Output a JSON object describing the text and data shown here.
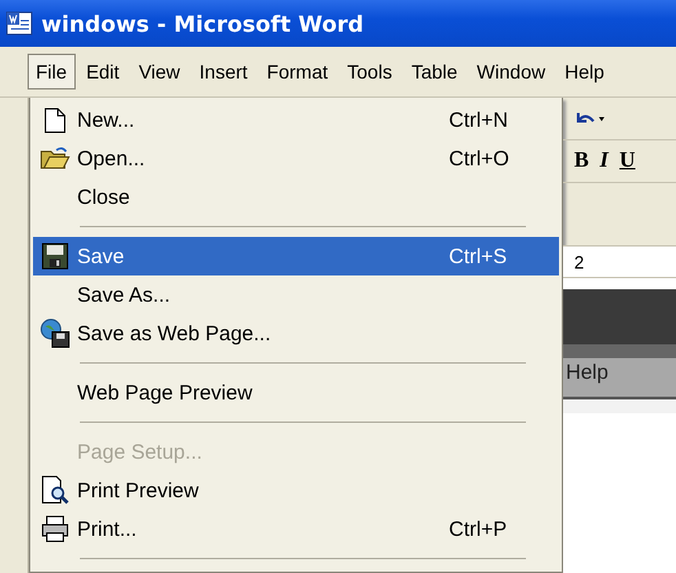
{
  "window": {
    "title": "windows - Microsoft Word"
  },
  "menu_bar": [
    {
      "label": "File",
      "selected": true
    },
    {
      "label": "Edit",
      "selected": false
    },
    {
      "label": "View",
      "selected": false
    },
    {
      "label": "Insert",
      "selected": false
    },
    {
      "label": "Format",
      "selected": false
    },
    {
      "label": "Tools",
      "selected": false
    },
    {
      "label": "Table",
      "selected": false
    },
    {
      "label": "Window",
      "selected": false
    },
    {
      "label": "Help",
      "selected": false
    }
  ],
  "file_menu": [
    {
      "kind": "item",
      "label": "New...",
      "shortcut": "Ctrl+N",
      "selected": false,
      "disabled": false
    },
    {
      "kind": "item",
      "label": "Open...",
      "shortcut": "Ctrl+O",
      "selected": false,
      "disabled": false
    },
    {
      "kind": "item",
      "label": "Close",
      "selected": false,
      "disabled": false
    },
    {
      "kind": "separator"
    },
    {
      "kind": "item",
      "label": "Save",
      "shortcut": "Ctrl+S",
      "selected": true,
      "disabled": false
    },
    {
      "kind": "item",
      "label": "Save As...",
      "selected": false,
      "disabled": false
    },
    {
      "kind": "item",
      "label": "Save as Web Page...",
      "selected": false,
      "disabled": false
    },
    {
      "kind": "separator"
    },
    {
      "kind": "item",
      "label": "Web Page Preview",
      "selected": false,
      "disabled": false
    },
    {
      "kind": "separator"
    },
    {
      "kind": "item",
      "label": "Page Setup...",
      "selected": false,
      "disabled": true
    },
    {
      "kind": "item",
      "label": "Print Preview",
      "selected": false,
      "disabled": false
    },
    {
      "kind": "item",
      "label": "Print...",
      "shortcut": "Ctrl+P",
      "selected": false,
      "disabled": false
    },
    {
      "kind": "separator"
    }
  ],
  "format_toolbar": [
    {
      "kind": "bold",
      "label": "B"
    },
    {
      "kind": "italic",
      "label": "I"
    },
    {
      "kind": "underline",
      "label": "U"
    }
  ],
  "ruler": {
    "label": "2"
  },
  "document": {
    "image_text": "Help"
  }
}
